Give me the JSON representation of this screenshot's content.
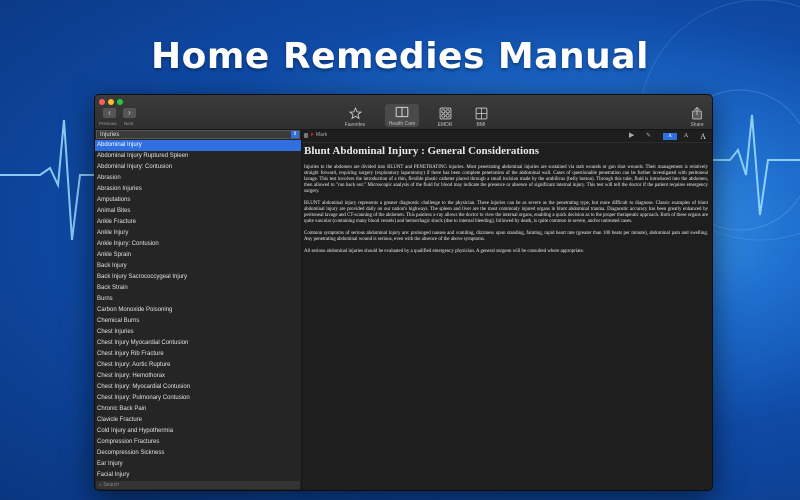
{
  "hero": {
    "title": "Home Remedies Manual"
  },
  "toolbar": {
    "previous_label": "Previous",
    "next_label": "Next",
    "items": [
      {
        "label": "Favorites",
        "icon": "star-icon"
      },
      {
        "label": "Health Care",
        "icon": "book-icon",
        "active": true
      },
      {
        "label": "EMDR",
        "icon": "grid-icon"
      },
      {
        "label": "BMI",
        "icon": "calculator-icon"
      }
    ],
    "share_label": "Share"
  },
  "sidebar": {
    "category": "Injuries",
    "items": [
      "Abdominal Injury",
      "Abdominal Injury Ruptured Spleen",
      "Abdominal Injury: Contusion",
      "Abrasion",
      "Abrasion Injuries",
      "Amputations",
      "Animal Bites",
      "Ankle Fracture",
      "Ankle Injury",
      "Ankle Injury: Contusion",
      "Ankle Sprain",
      "Back Injury",
      "Back Injury  Sacrococcygeal Injury",
      "Back Strain",
      "Burns",
      "Carbon Monoxide Poisoning",
      "Chemical Burns",
      "Chest Injuries",
      "Chest Injury Myocardial Contusion",
      "Chest Injury Rib Fracture",
      "Chest Injury: Aortic Rupture",
      "Chest Injury: Hemothorax",
      "Chest Injury: Myocardial Contusion",
      "Chest Injury: Pulmonary Contusion",
      "Chronic Back Pain",
      "Clavicle Fracture",
      "Cold Injury and Hypothermia",
      "Compression Fractures",
      "Decompression Sickness",
      "Ear Injury",
      "Facial Injury"
    ],
    "selected_index": 0,
    "search_placeholder": "Search"
  },
  "content": {
    "mark_label": "Mark",
    "font_sizes": [
      "A",
      "A",
      "A"
    ],
    "title": "Blunt Abdominal Injury : General Considerations",
    "paragraphs": [
      "Injuries to the abdomen are divided into BLUNT and PENETRATING injuries. Most penetrating abdominal injuries are sustained via stab wounds or gun shot wounds. Their management is relatively straight forward, requiring surgery (exploratory laparotomy) if there has been complete penetration of the abdominal wall. Cases of questionable penetration can be further investigated with peritoneal lavage. This test involves the introduction of a thin, flexible plastic catheter placed through a small incision made by the umbilicus (belly button). Through this tube, fluid is introduced into the abdomen, then allowed to \"run back out.\" Microscopic analysis of the fluid for blood may indicate the presence or absence of significant internal injury. This test will tell the doctor if the patient requires emergency surgery.",
      "BLUNT abdominal injury represents a greater diagnostic challenge to the physician. These injuries can be as severe as the penetrating type, but more difficult to diagnose. Classic examples of blunt abdominal injury are provided daily on our nation's highways. The spleen and liver are the most commonly injured organs in blunt abdominal trauma. Diagnostic accuracy has been greatly enhanced by peritoneal lavage and CT-scanning of the abdomen. This painless x-ray allows the doctor to view the internal organs, enabling a quick decision as to the proper therapeutic approach. Both of these organs are quite vascular (containing many blood vessels) and hemorrhagic shock (due to internal bleeding), followed by death, is quite common in severe, and/or untreated cases.",
      "Common symptoms of serious abdominal injury are: prolonged nausea and vomiting, dizziness upon standing, fainting, rapid heart rate (greater than 100 beats per minute), abdominal pain and swelling. Any penetrating abdominal wound is serious, even with the absence of the above symptoms.",
      "All serious abdominal injuries should be evaluated by a qualified emergency physician. A general surgeon will be consulted where appropriate."
    ]
  },
  "colors": {
    "accent": "#2f6fe0",
    "background": "#1e1e1e",
    "ecg": "#7fd4ff"
  }
}
